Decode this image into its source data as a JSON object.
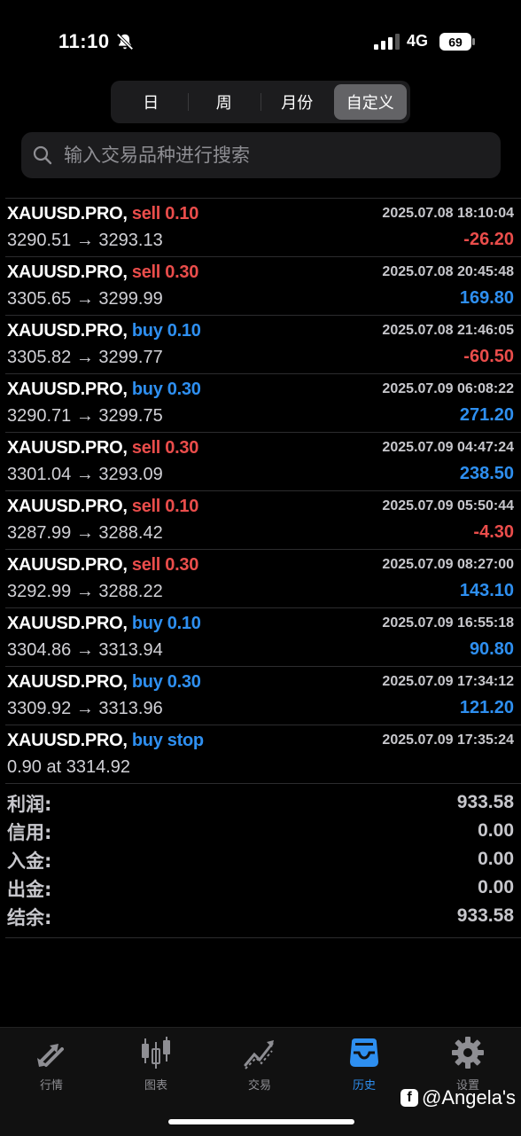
{
  "status_bar": {
    "time": "11:10",
    "network": "4G",
    "battery": "69"
  },
  "period_tabs": [
    {
      "label": "日",
      "active": false
    },
    {
      "label": "周",
      "active": false
    },
    {
      "label": "月份",
      "active": false
    },
    {
      "label": "自定义",
      "active": true
    }
  ],
  "search": {
    "placeholder": "输入交易品种进行搜索"
  },
  "trades": [
    {
      "symbol": "XAUUSD.PRO,",
      "side": "sell 0.10",
      "side_type": "sell",
      "datetime": "2025.07.08 18:10:04",
      "prices": "3290.51 → 3293.13",
      "profit": "-26.20",
      "profit_type": "neg"
    },
    {
      "symbol": "XAUUSD.PRO,",
      "side": "sell 0.30",
      "side_type": "sell",
      "datetime": "2025.07.08 20:45:48",
      "prices": "3305.65 → 3299.99",
      "profit": "169.80",
      "profit_type": "pos"
    },
    {
      "symbol": "XAUUSD.PRO,",
      "side": "buy 0.10",
      "side_type": "buy",
      "datetime": "2025.07.08 21:46:05",
      "prices": "3305.82 → 3299.77",
      "profit": "-60.50",
      "profit_type": "neg"
    },
    {
      "symbol": "XAUUSD.PRO,",
      "side": "buy 0.30",
      "side_type": "buy",
      "datetime": "2025.07.09 06:08:22",
      "prices": "3290.71 → 3299.75",
      "profit": "271.20",
      "profit_type": "pos"
    },
    {
      "symbol": "XAUUSD.PRO,",
      "side": "sell 0.30",
      "side_type": "sell",
      "datetime": "2025.07.09 04:47:24",
      "prices": "3301.04 → 3293.09",
      "profit": "238.50",
      "profit_type": "pos"
    },
    {
      "symbol": "XAUUSD.PRO,",
      "side": "sell 0.10",
      "side_type": "sell",
      "datetime": "2025.07.09 05:50:44",
      "prices": "3287.99 → 3288.42",
      "profit": "-4.30",
      "profit_type": "neg"
    },
    {
      "symbol": "XAUUSD.PRO,",
      "side": "sell 0.30",
      "side_type": "sell",
      "datetime": "2025.07.09 08:27:00",
      "prices": "3292.99 → 3288.22",
      "profit": "143.10",
      "profit_type": "pos"
    },
    {
      "symbol": "XAUUSD.PRO,",
      "side": "buy 0.10",
      "side_type": "buy",
      "datetime": "2025.07.09 16:55:18",
      "prices": "3304.86 → 3313.94",
      "profit": "90.80",
      "profit_type": "pos"
    },
    {
      "symbol": "XAUUSD.PRO,",
      "side": "buy 0.30",
      "side_type": "buy",
      "datetime": "2025.07.09 17:34:12",
      "prices": "3309.92 → 3313.96",
      "profit": "121.20",
      "profit_type": "pos"
    },
    {
      "symbol": "XAUUSD.PRO,",
      "side": "buy stop",
      "side_type": "buy",
      "datetime": "2025.07.09 17:35:24",
      "prices": "0.90 at 3314.92",
      "profit": "",
      "profit_type": "none"
    }
  ],
  "summary": [
    {
      "label": "利润:",
      "value": "933.58"
    },
    {
      "label": "信用:",
      "value": "0.00"
    },
    {
      "label": "入金:",
      "value": "0.00"
    },
    {
      "label": "出金:",
      "value": "0.00"
    },
    {
      "label": "结余:",
      "value": "933.58"
    }
  ],
  "tab_bar": [
    {
      "label": "行情",
      "icon": "quotes-arrows-icon",
      "active": false
    },
    {
      "label": "图表",
      "icon": "candlestick-icon",
      "active": false
    },
    {
      "label": "交易",
      "icon": "trade-chart-icon",
      "active": false
    },
    {
      "label": "历史",
      "icon": "history-inbox-icon",
      "active": true
    },
    {
      "label": "设置",
      "icon": "gear-icon",
      "active": false
    }
  ],
  "watermark": {
    "text": "@Angela's"
  },
  "colors": {
    "sell": "#ea4d4b",
    "buy": "#2e8ff0",
    "negative": "#ea4d4b",
    "positive": "#2e8ff0",
    "active_tab": "#2e8ff0"
  }
}
